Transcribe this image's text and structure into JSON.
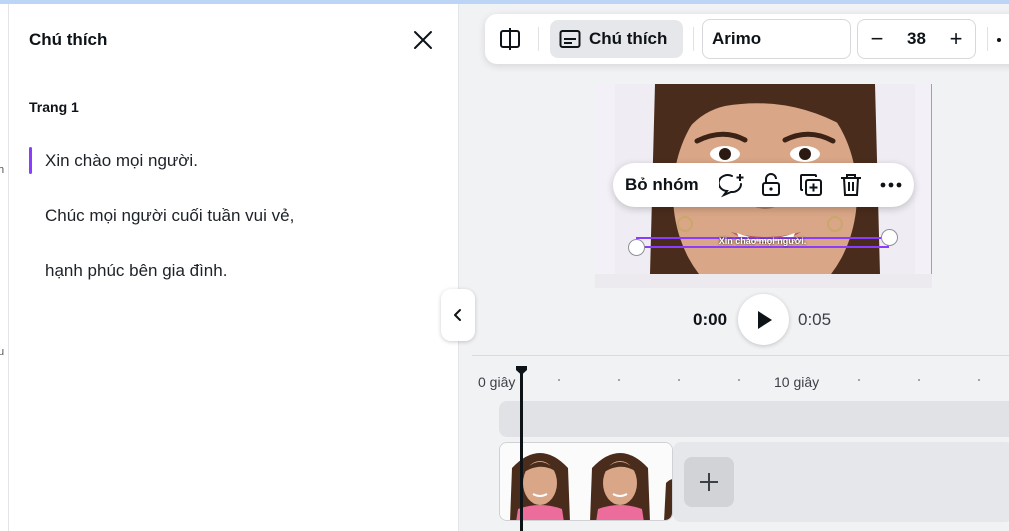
{
  "left_strip": {
    "label_a": "h",
    "label_b": "u"
  },
  "captions_panel": {
    "title": "Chú thích",
    "page_label": "Trang 1",
    "lines": [
      "Xin chào mọi người.",
      "Chúc mọi người cuối tuần vui vẻ,",
      "hạnh phúc bên gia đình."
    ]
  },
  "toolbar": {
    "caption_label": "Chú thích",
    "font_name": "Arimo",
    "font_size": "38",
    "minus": "−",
    "plus": "+"
  },
  "context_menu": {
    "ungroup_label": "Bỏ nhóm"
  },
  "canvas": {
    "caption_text": "Xin chào mọi người."
  },
  "playback": {
    "current_time": "0:00",
    "total_time": "0:05"
  },
  "timeline": {
    "ruler_start": "0 giây",
    "ruler_mid": "10 giây"
  },
  "colors": {
    "accent": "#8b3dff",
    "skin": "#d9a687",
    "hair": "#4a2c1c",
    "clothes": "#ec6d9c"
  }
}
